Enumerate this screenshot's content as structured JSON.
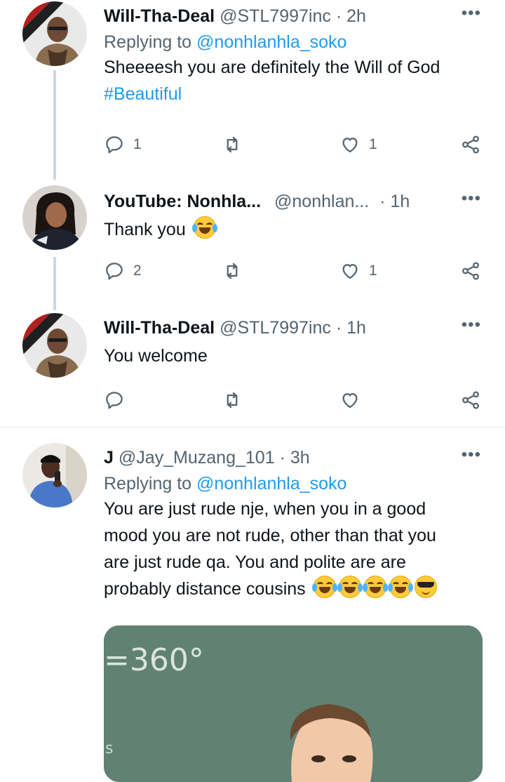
{
  "tweets": [
    {
      "name": "Will-Tha-Deal",
      "handle": "@STL7997inc",
      "time": "2h",
      "replying_label": "Replying to",
      "replying_to": "@nonhlanhla_soko",
      "text": "Sheeeesh you are definitely the Will of God",
      "hashtag": "#Beautiful",
      "replies": "1",
      "retweets": "",
      "likes": "1"
    },
    {
      "name": "YouTube: Nonhla...",
      "handle": "@nonhlan...",
      "time": "1h",
      "text": "Thank you",
      "replies": "2",
      "retweets": "",
      "likes": "1"
    },
    {
      "name": "Will-Tha-Deal",
      "handle": "@STL7997inc",
      "time": "1h",
      "text": "You welcome",
      "replies": "",
      "retweets": "",
      "likes": ""
    },
    {
      "name": "J",
      "handle": "@Jay_Muzang_101",
      "time": "3h",
      "replying_label": "Replying to",
      "replying_to": "@nonhlanhla_soko",
      "text_lines": [
        "You are just rude nje, when you in a good",
        "mood you are not rude, other than that you",
        "are just rude qa. You and polite are are",
        "probably distance cousins"
      ],
      "media_text": "=360°"
    }
  ],
  "separator": "·",
  "more_glyph": "•••",
  "icons": [
    "reply-icon",
    "retweet-icon",
    "like-icon",
    "share-icon",
    "more-icon",
    "laughing-emoji",
    "cool-emoji"
  ],
  "colors": {
    "link": "#1d9bf0",
    "secondary": "#536471",
    "thread_line": "#cfd9de"
  }
}
